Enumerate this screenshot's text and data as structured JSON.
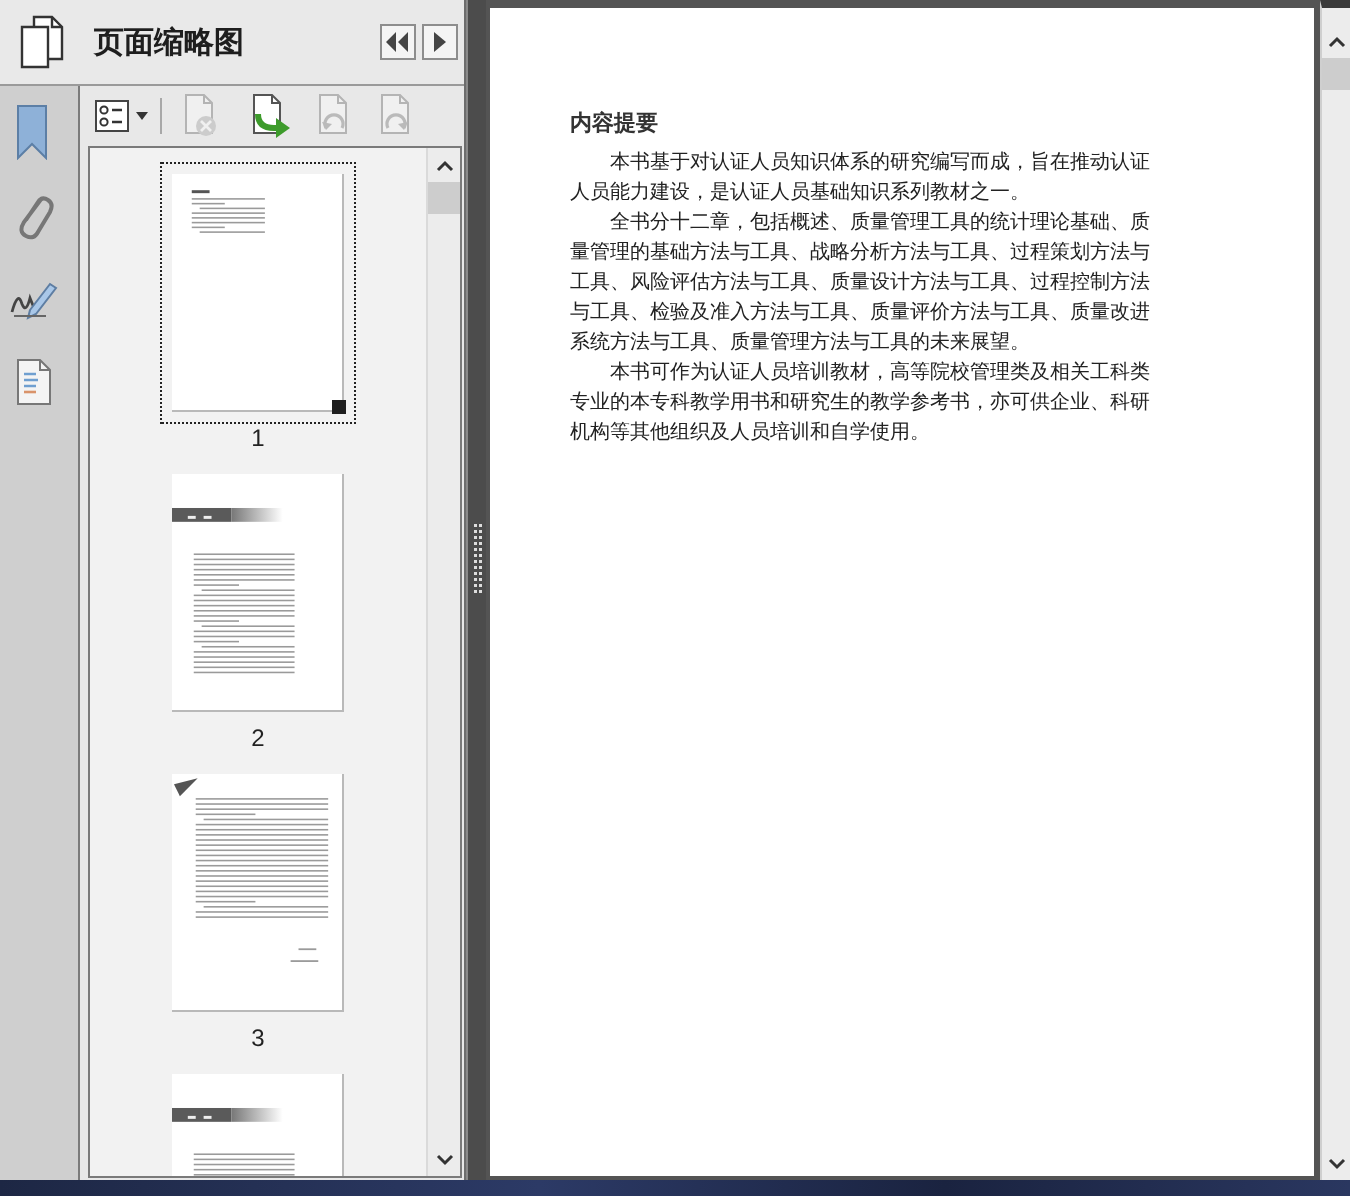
{
  "panel": {
    "title": "页面缩略图"
  },
  "toolbar": [
    {
      "kind": "options",
      "disabled": false
    },
    {
      "kind": "delete",
      "disabled": true
    },
    {
      "kind": "insert",
      "disabled": false
    },
    {
      "kind": "rotate_left",
      "disabled": true
    },
    {
      "kind": "rotate_right",
      "disabled": true
    }
  ],
  "thumbnails": [
    {
      "kind": "summary",
      "label": "1",
      "selected": true
    },
    {
      "kind": "chapter",
      "label": "2",
      "selected": false
    },
    {
      "kind": "text",
      "label": "3",
      "selected": false
    },
    {
      "kind": "chapter",
      "selected": false
    }
  ],
  "document": {
    "heading": "内容提要",
    "paragraphs": [
      "本书基于对认证人员知识体系的研究编写而成，旨在推动认证人员能力建设，是认证人员基础知识系列教材之一。",
      "全书分十二章，包括概述、质量管理工具的统计理论基础、质量管理的基础方法与工具、战略分析方法与工具、过程策划方法与工具、风险评估方法与工具、质量设计方法与工具、过程控制方法与工具、检验及准入方法与工具、质量评价方法与工具、质量改进系统方法与工具、质量管理方法与工具的未来展望。",
      "本书可作为认证人员培训教材，高等院校管理类及相关工科类专业的本专科教学用书和研究生的教学参考书，亦可供企业、科研机构等其他组织及人员培训和自学使用。"
    ]
  }
}
